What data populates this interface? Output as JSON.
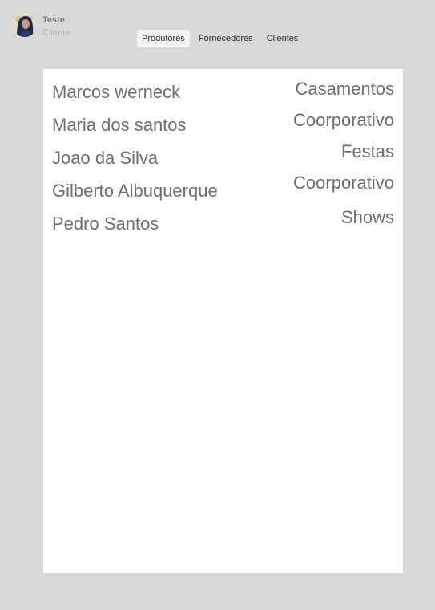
{
  "user": {
    "name": "Teste",
    "role": "Cliente"
  },
  "tabs": [
    {
      "label": "Produtores",
      "active": true
    },
    {
      "label": "Fornecedores",
      "active": false
    },
    {
      "label": "Clientes",
      "active": false
    }
  ],
  "list": [
    {
      "name": "Marcos werneck",
      "category": "Casamentos"
    },
    {
      "name": "Maria dos santos",
      "category": "Coorporativo"
    },
    {
      "name": "Joao da Silva",
      "category": "Festas"
    },
    {
      "name": "Gilberto Albuquerque",
      "category": "Coorporativo"
    },
    {
      "name": "Pedro Santos",
      "category": "Shows"
    }
  ]
}
